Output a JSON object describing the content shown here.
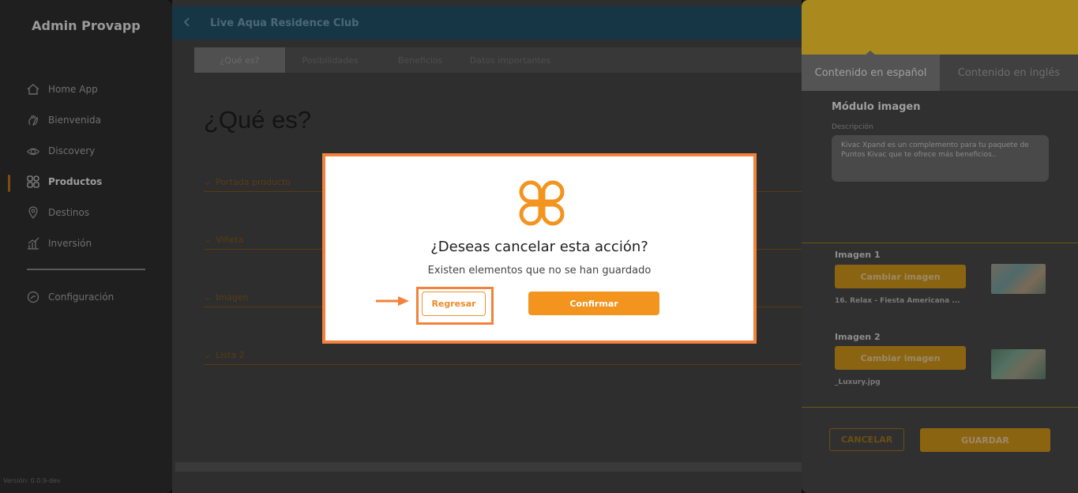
{
  "sidebar": {
    "brand": "Admin Provapp",
    "items": [
      {
        "label": "Home App",
        "icon": "home-icon"
      },
      {
        "label": "Bienvenida",
        "icon": "hand-wave-icon"
      },
      {
        "label": "Discovery",
        "icon": "eye-icon"
      },
      {
        "label": "Productos",
        "icon": "grid-icon",
        "active": true
      },
      {
        "label": "Destinos",
        "icon": "location-pin-icon"
      },
      {
        "label": "Inversión",
        "icon": "bar-chart-icon"
      }
    ],
    "settings_label": "Configuración",
    "version": "Versión: 0.0.9-dev"
  },
  "header": {
    "title": "Live Aqua Residence Club",
    "back_icon": "chevron-left-icon"
  },
  "tabs": [
    "¿Qué es?",
    "Posibilidades",
    "Beneficios",
    "Datos importantes"
  ],
  "main": {
    "heading": "¿Qué es?",
    "sections": [
      "Portada producto",
      "Viñeta",
      "Imagen",
      "Lista 2"
    ]
  },
  "panel": {
    "lang_tabs": [
      "Contenido en español",
      "Contenido en inglés"
    ],
    "module_title": "Módulo imagen",
    "description_label": "Descripción",
    "description_value": "Kivac Xpand es un complemento para tu paquete de Puntos Kivac que te ofrece más beneficios..",
    "images": [
      {
        "label": "Imagen 1",
        "button": "Cambiar imagen",
        "file": "16. Relax - Fiesta Americana ..."
      },
      {
        "label": "Imagen 2",
        "button": "Cambiar imagen",
        "file": "_Luxury.jpg"
      }
    ],
    "cancel_label": "CANCELAR",
    "save_label": "GUARDAR"
  },
  "modal": {
    "title": "¿Deseas cancelar esta acción?",
    "subtitle": "Existen elementos que no se han guardado",
    "back_label": "Regresar",
    "confirm_label": "Confirmar",
    "logo_icon": "clover-logo-icon",
    "arrow_icon": "arrow-right-icon"
  },
  "colors": {
    "accent": "#f3941f",
    "highlight": "#f2823c",
    "header_bg": "#163646",
    "panel_top": "#aa8a1f"
  }
}
